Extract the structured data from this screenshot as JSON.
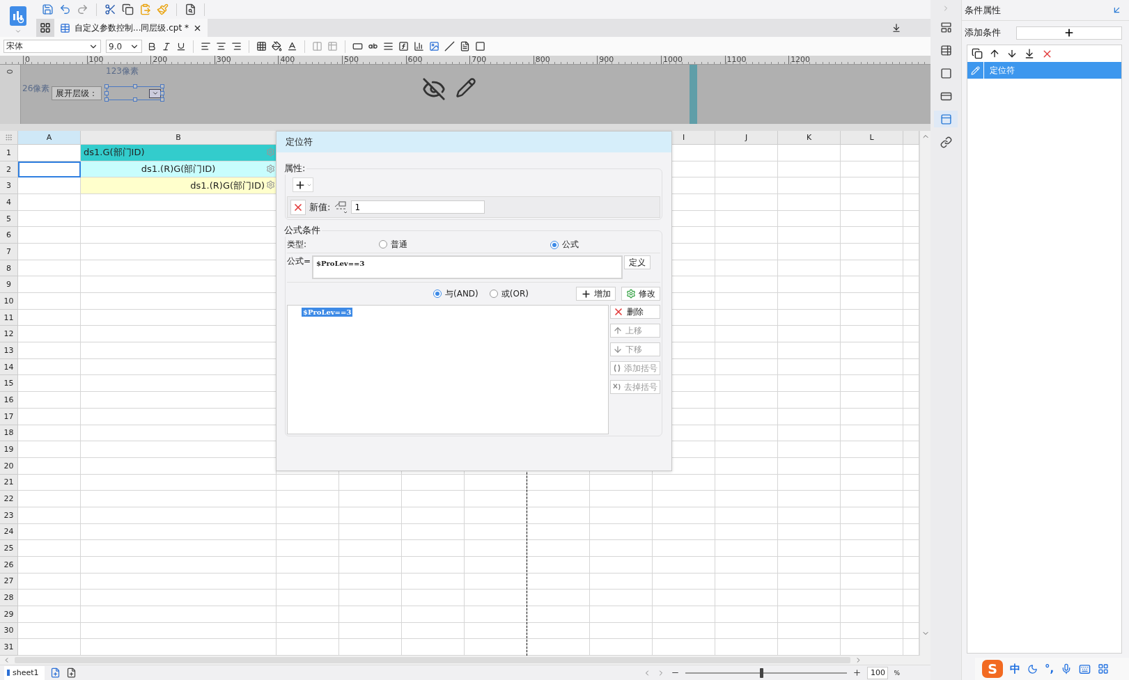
{
  "document_tabs": [
    {
      "label": "自定义参数控制...同层级.cpt *",
      "selected": true
    }
  ],
  "format_bar": {
    "font": "宋体",
    "size": "9.0"
  },
  "ruler": {
    "ticks": [
      "0",
      "100",
      "200",
      "300",
      "400",
      "500",
      "600",
      "700",
      "800",
      "900",
      "1000",
      "1100",
      "1200"
    ],
    "vertical_ticks": [
      "0"
    ]
  },
  "parameter_pane": {
    "width_hint": "123像素",
    "height_hint": "26像素",
    "label": "展开层级："
  },
  "sheet": {
    "page_break": true,
    "columns": [
      {
        "label": "A",
        "selected": true
      },
      {
        "label": "B",
        "selected": false
      },
      {
        "label": "I",
        "selected": false
      },
      {
        "label": "J",
        "selected": false
      },
      {
        "label": "K",
        "selected": false
      },
      {
        "label": "L",
        "selected": false
      }
    ],
    "rows": [
      {
        "label": "1",
        "selected": false,
        "content": {
          "text": "ds1.G(部门ID)",
          "color": "#33cccc",
          "kind": "left"
        }
      },
      {
        "label": "2",
        "selected": true,
        "content": {
          "text": "ds1.(R)G(部门ID)",
          "color": "#c8fdfd",
          "kind": "center"
        }
      },
      {
        "label": "3",
        "selected": false,
        "content": {
          "text": "ds1.(R)G(部门ID)",
          "color": "#ffffcc",
          "kind": "right"
        }
      },
      {
        "label": "4",
        "selected": false
      },
      {
        "label": "5",
        "selected": false
      },
      {
        "label": "6",
        "selected": false
      },
      {
        "label": "7",
        "selected": false
      },
      {
        "label": "8",
        "selected": false
      },
      {
        "label": "9",
        "selected": false
      },
      {
        "label": "10",
        "selected": false
      },
      {
        "label": "11",
        "selected": false
      },
      {
        "label": "12",
        "selected": false
      },
      {
        "label": "13",
        "selected": false
      },
      {
        "label": "14",
        "selected": false
      },
      {
        "label": "15",
        "selected": false
      },
      {
        "label": "16",
        "selected": false
      },
      {
        "label": "17",
        "selected": false
      },
      {
        "label": "18",
        "selected": false
      },
      {
        "label": "19",
        "selected": false
      },
      {
        "label": "20",
        "selected": false
      },
      {
        "label": "21",
        "selected": false
      },
      {
        "label": "22",
        "selected": false
      },
      {
        "label": "23",
        "selected": false
      },
      {
        "label": "24",
        "selected": false
      },
      {
        "label": "25",
        "selected": false
      },
      {
        "label": "26",
        "selected": false
      },
      {
        "label": "27",
        "selected": false
      },
      {
        "label": "28",
        "selected": false
      },
      {
        "label": "29",
        "selected": false
      },
      {
        "label": "30",
        "selected": false
      },
      {
        "label": "31",
        "selected": false
      }
    ]
  },
  "dialog": {
    "title": "定位符",
    "properties": {
      "legend": "属性:",
      "value_label": "新值:",
      "value": "1"
    },
    "formula_condition": {
      "legend": "公式条件",
      "type_label": "类型:",
      "types": [
        {
          "label": "普通",
          "selected": false
        },
        {
          "label": "公式",
          "selected": true
        }
      ],
      "formula_label": "公式=",
      "formula": "$ProLev==3",
      "define_button": "定义",
      "joins": [
        {
          "label": "与(AND)",
          "selected": true
        },
        {
          "label": "或(OR)",
          "selected": false
        }
      ],
      "add_button": "增加",
      "modify_button": "修改",
      "conditions": [
        {
          "text": "$ProLev==3",
          "selected": true
        }
      ],
      "actions": [
        {
          "kind": "delete",
          "label": "删除",
          "disabled": false
        },
        {
          "kind": "up",
          "label": "上移",
          "disabled": true
        },
        {
          "kind": "down",
          "label": "下移",
          "disabled": true
        },
        {
          "kind": "add_parens",
          "label": "添加括号",
          "disabled": true
        },
        {
          "kind": "remove_parens",
          "label": "去掉括号",
          "disabled": true
        }
      ]
    }
  },
  "side_tools": [
    {
      "selected": false
    },
    {
      "selected": false
    },
    {
      "selected": false
    },
    {
      "selected": false
    },
    {
      "selected": true
    },
    {
      "selected": false
    }
  ],
  "condition_panel": {
    "title": "条件属性",
    "add_label": "添加条件",
    "items": [
      {
        "label": "定位符",
        "selected": true
      }
    ]
  },
  "sheet_tabs": [
    {
      "label": "sheet1",
      "selected": true
    }
  ],
  "zoom": {
    "level": 0.47,
    "value": "100",
    "unit": "%"
  },
  "ime_bar": {
    "logo": "S",
    "mode": "中",
    "punctuation": "°,"
  }
}
